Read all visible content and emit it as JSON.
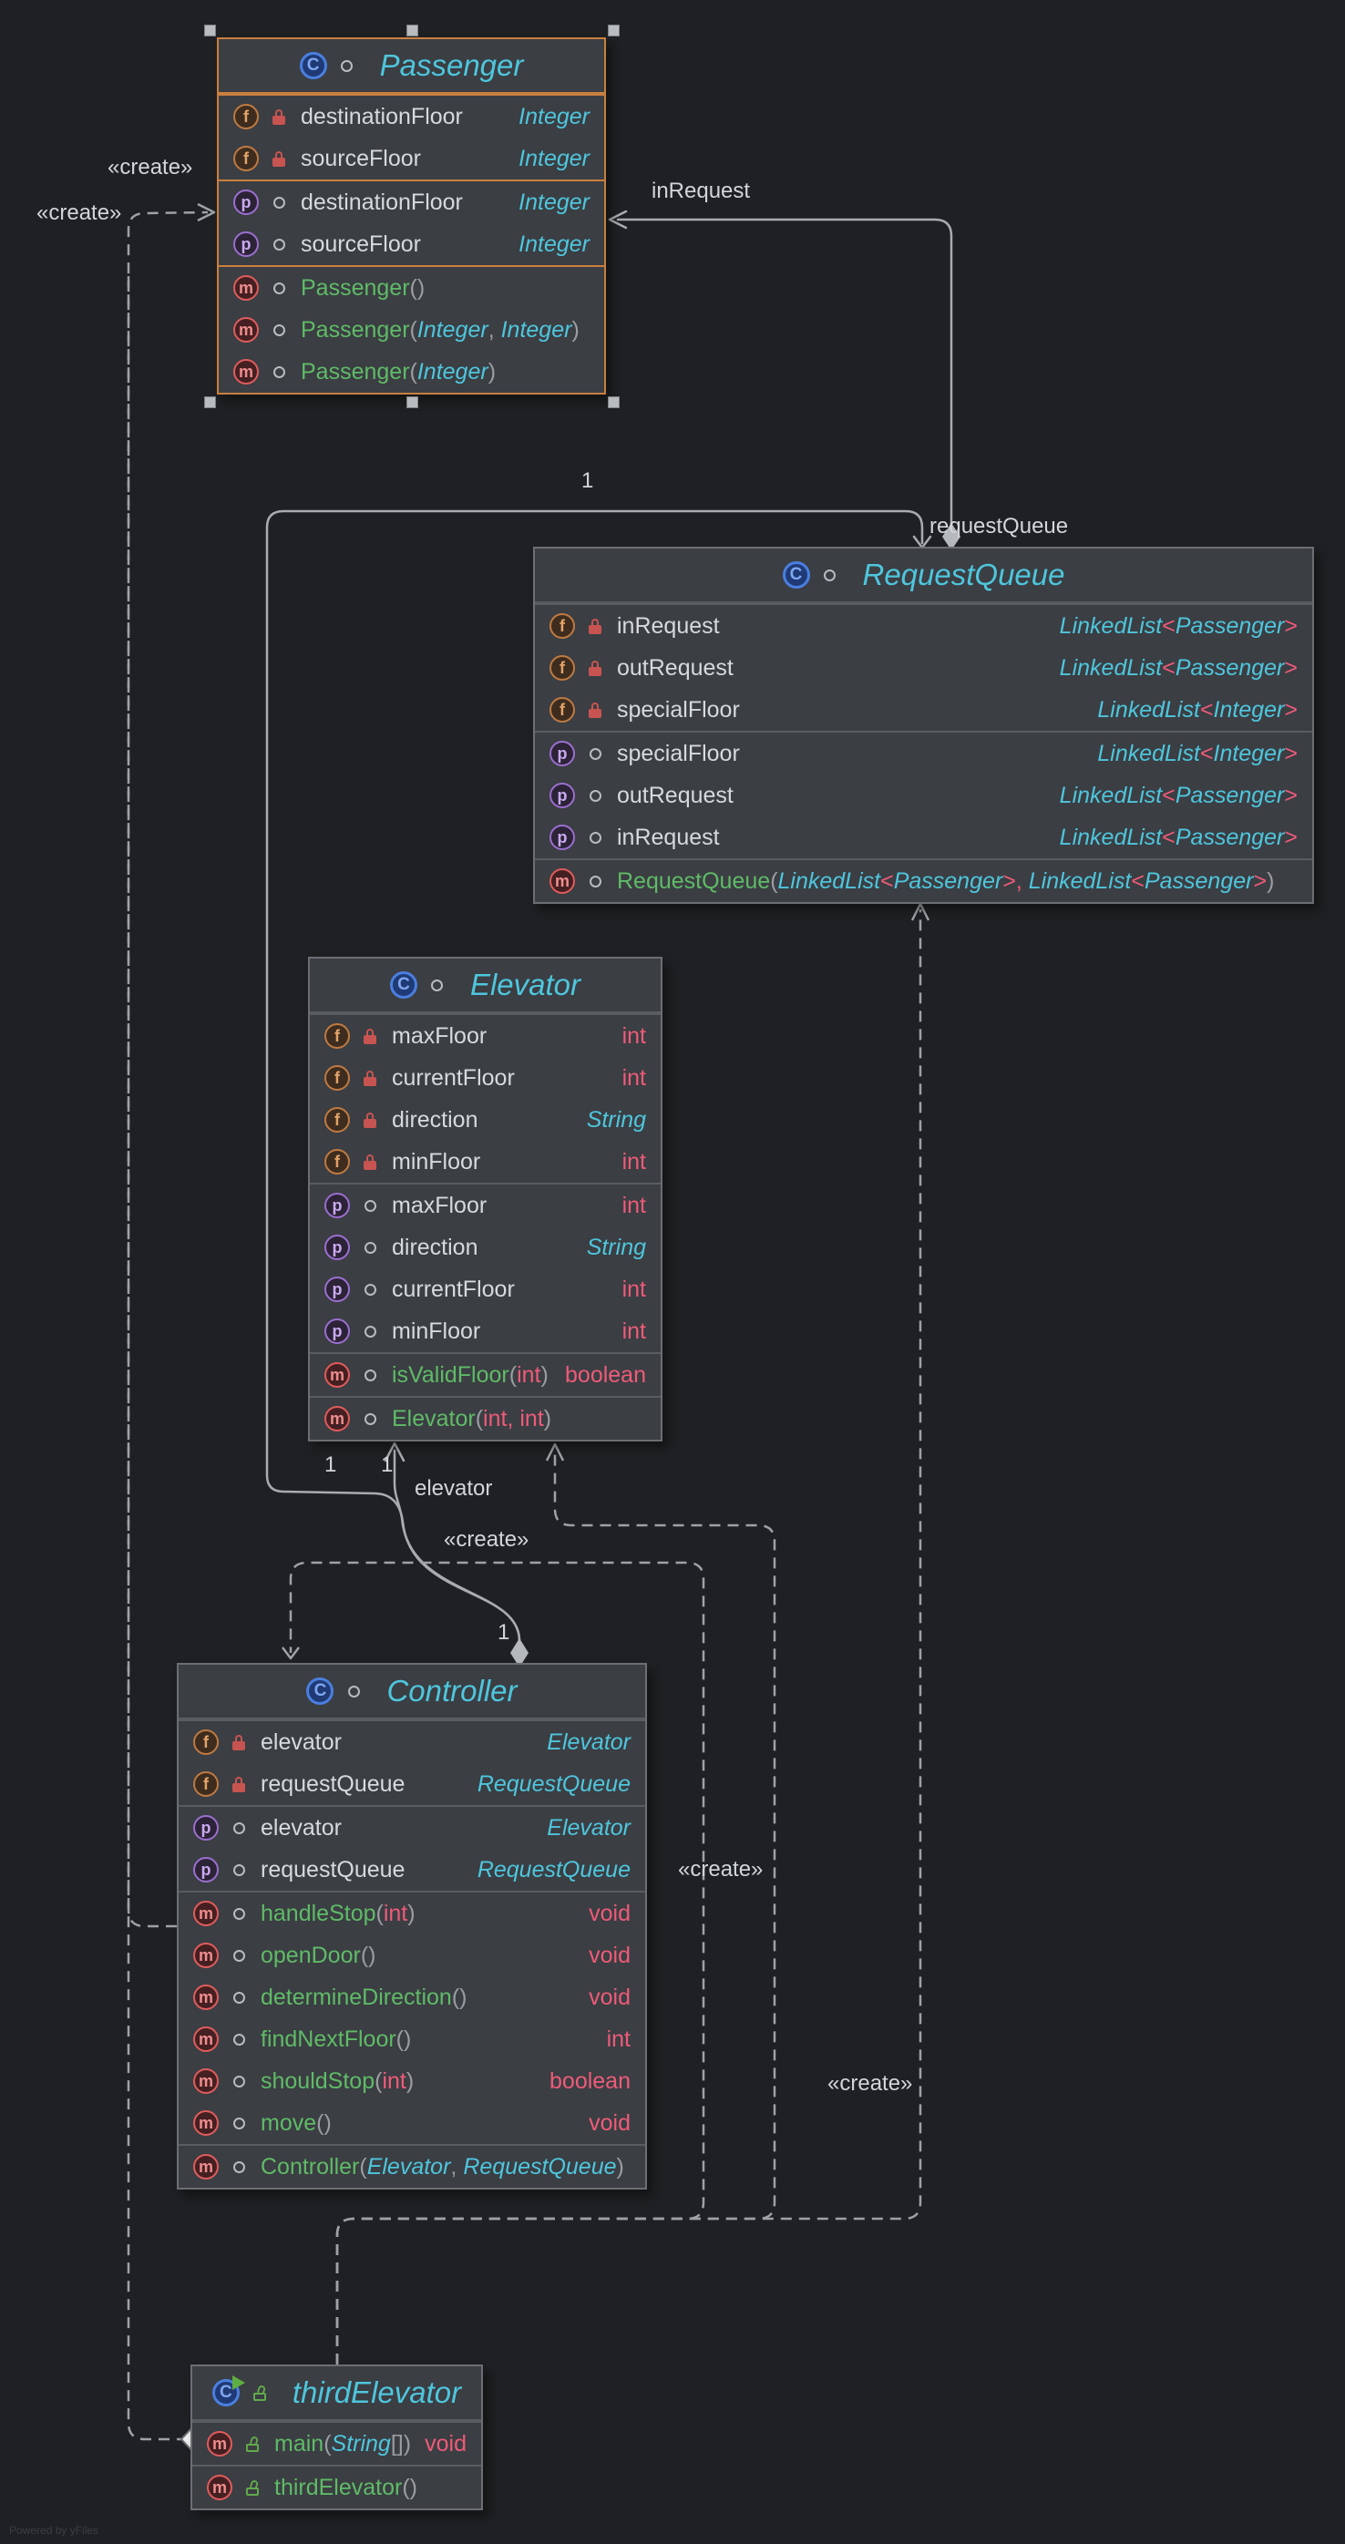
{
  "diagram": {
    "watermark": "Powered by yFiles",
    "labels": {
      "create": "«create»",
      "in_request": "inRequest",
      "request_queue": "requestQueue",
      "elevator": "elevator",
      "one": "1"
    },
    "colors": {
      "background": "#1e2023",
      "node_fill": "#3b3e43",
      "node_border": "#6b6e73",
      "selected_border": "#c9803f",
      "title_cyan": "#4ec6dd",
      "method_green": "#5fbb67",
      "primitive_pink": "#ee5b79",
      "edge_gray": "#a6a9ac"
    },
    "classes": [
      {
        "id": "passenger",
        "title": "Passenger",
        "icon": "class",
        "selected": true,
        "sections": [
          [
            {
              "kind": "f",
              "access": "private",
              "name": "destinationFloor",
              "type": [
                [
                  "Integer",
                  "sc"
                ]
              ]
            },
            {
              "kind": "f",
              "access": "private",
              "name": "sourceFloor",
              "type": [
                [
                  "Integer",
                  "sc"
                ]
              ]
            }
          ],
          [
            {
              "kind": "p",
              "access": "public",
              "name": "destinationFloor",
              "type": [
                [
                  "Integer",
                  "sc"
                ]
              ]
            },
            {
              "kind": "p",
              "access": "public",
              "name": "sourceFloor",
              "type": [
                [
                  "Integer",
                  "sc"
                ]
              ]
            }
          ],
          [
            {
              "kind": "m",
              "access": "public",
              "name": "Passenger",
              "sig": [
                [
                  "()",
                  "sg"
                ]
              ]
            },
            {
              "kind": "m",
              "access": "public",
              "name": "Passenger",
              "sig": [
                [
                  "(",
                  "sg"
                ],
                [
                  "Integer",
                  "sc"
                ],
                [
                  ", ",
                  "sg"
                ],
                [
                  "Integer",
                  "sc"
                ],
                [
                  ")",
                  "sg"
                ]
              ]
            },
            {
              "kind": "m",
              "access": "public",
              "name": "Passenger",
              "sig": [
                [
                  "(",
                  "sg"
                ],
                [
                  "Integer",
                  "sc"
                ],
                [
                  ")",
                  "sg"
                ]
              ]
            }
          ]
        ]
      },
      {
        "id": "requestqueue",
        "title": "RequestQueue",
        "icon": "class",
        "selected": false,
        "sections": [
          [
            {
              "kind": "f",
              "access": "private",
              "name": "inRequest",
              "type": [
                [
                  "LinkedList",
                  "sc"
                ],
                [
                  "<",
                  "sk"
                ],
                [
                  "Passenger",
                  "sc"
                ],
                [
                  ">",
                  "sk"
                ]
              ]
            },
            {
              "kind": "f",
              "access": "private",
              "name": "outRequest",
              "type": [
                [
                  "LinkedList",
                  "sc"
                ],
                [
                  "<",
                  "sk"
                ],
                [
                  "Passenger",
                  "sc"
                ],
                [
                  ">",
                  "sk"
                ]
              ]
            },
            {
              "kind": "f",
              "access": "private",
              "name": "specialFloor",
              "type": [
                [
                  "LinkedList",
                  "sc"
                ],
                [
                  "<",
                  "sk"
                ],
                [
                  "Integer",
                  "sc"
                ],
                [
                  ">",
                  "sk"
                ]
              ]
            }
          ],
          [
            {
              "kind": "p",
              "access": "public",
              "name": "specialFloor",
              "type": [
                [
                  "LinkedList",
                  "sc"
                ],
                [
                  "<",
                  "sk"
                ],
                [
                  "Integer",
                  "sc"
                ],
                [
                  ">",
                  "sk"
                ]
              ]
            },
            {
              "kind": "p",
              "access": "public",
              "name": "outRequest",
              "type": [
                [
                  "LinkedList",
                  "sc"
                ],
                [
                  "<",
                  "sk"
                ],
                [
                  "Passenger",
                  "sc"
                ],
                [
                  ">",
                  "sk"
                ]
              ]
            },
            {
              "kind": "p",
              "access": "public",
              "name": "inRequest",
              "type": [
                [
                  "LinkedList",
                  "sc"
                ],
                [
                  "<",
                  "sk"
                ],
                [
                  "Passenger",
                  "sc"
                ],
                [
                  ">",
                  "sk"
                ]
              ]
            }
          ],
          [
            {
              "kind": "m",
              "access": "public",
              "name": "RequestQueue",
              "sig": [
                [
                  "(",
                  "sg"
                ],
                [
                  "LinkedList",
                  "sc"
                ],
                [
                  "<",
                  "sk"
                ],
                [
                  "Passenger",
                  "sc"
                ],
                [
                  ">",
                  "sk"
                ],
                [
                  ", ",
                  "sk"
                ],
                [
                  "LinkedList",
                  "sc"
                ],
                [
                  "<",
                  "sk"
                ],
                [
                  "Passenger",
                  "sc"
                ],
                [
                  ">",
                  "sk"
                ],
                [
                  ")",
                  "sg"
                ]
              ]
            }
          ]
        ]
      },
      {
        "id": "elevator",
        "title": "Elevator",
        "icon": "class",
        "selected": false,
        "sections": [
          [
            {
              "kind": "f",
              "access": "private",
              "name": "maxFloor",
              "type": [
                [
                  "int",
                  "sp"
                ]
              ]
            },
            {
              "kind": "f",
              "access": "private",
              "name": "currentFloor",
              "type": [
                [
                  "int",
                  "sp"
                ]
              ]
            },
            {
              "kind": "f",
              "access": "private",
              "name": "direction",
              "type": [
                [
                  "String",
                  "sc"
                ]
              ]
            },
            {
              "kind": "f",
              "access": "private",
              "name": "minFloor",
              "type": [
                [
                  "int",
                  "sp"
                ]
              ]
            }
          ],
          [
            {
              "kind": "p",
              "access": "public",
              "name": "maxFloor",
              "type": [
                [
                  "int",
                  "sp"
                ]
              ]
            },
            {
              "kind": "p",
              "access": "public",
              "name": "direction",
              "type": [
                [
                  "String",
                  "sc"
                ]
              ]
            },
            {
              "kind": "p",
              "access": "public",
              "name": "currentFloor",
              "type": [
                [
                  "int",
                  "sp"
                ]
              ]
            },
            {
              "kind": "p",
              "access": "public",
              "name": "minFloor",
              "type": [
                [
                  "int",
                  "sp"
                ]
              ]
            }
          ],
          [
            {
              "kind": "m",
              "access": "public",
              "name": "isValidFloor",
              "sig": [
                [
                  " (",
                  "sg"
                ],
                [
                  "int",
                  "sp"
                ],
                [
                  ")",
                  "sg"
                ]
              ],
              "type": [
                [
                  "boolean",
                  "sp"
                ]
              ]
            }
          ],
          [
            {
              "kind": "m",
              "access": "public",
              "name": "Elevator",
              "sig": [
                [
                  " (",
                  "sg"
                ],
                [
                  "int",
                  "sp"
                ],
                [
                  ", ",
                  "sp"
                ],
                [
                  "int",
                  "sp"
                ],
                [
                  ")",
                  "sg"
                ]
              ]
            }
          ]
        ]
      },
      {
        "id": "controller",
        "title": "Controller",
        "icon": "class",
        "selected": false,
        "sections": [
          [
            {
              "kind": "f",
              "access": "private",
              "name": "elevator",
              "type": [
                [
                  "Elevator",
                  "sc"
                ]
              ]
            },
            {
              "kind": "f",
              "access": "private",
              "name": "requestQueue",
              "type": [
                [
                  "RequestQueue",
                  "sc"
                ]
              ]
            }
          ],
          [
            {
              "kind": "p",
              "access": "public",
              "name": "elevator",
              "type": [
                [
                  "Elevator",
                  "sc"
                ]
              ]
            },
            {
              "kind": "p",
              "access": "public",
              "name": "requestQueue",
              "type": [
                [
                  "RequestQueue",
                  "sc"
                ]
              ]
            }
          ],
          [
            {
              "kind": "m",
              "access": "public",
              "name": "handleStop",
              "sig": [
                [
                  " (",
                  "sg"
                ],
                [
                  "int",
                  "sp"
                ],
                [
                  ")",
                  "sg"
                ]
              ],
              "type": [
                [
                  "void",
                  "sp"
                ]
              ]
            },
            {
              "kind": "m",
              "access": "public",
              "name": "openDoor",
              "sig": [
                [
                  " ()",
                  "sg"
                ]
              ],
              "type": [
                [
                  "void",
                  "sp"
                ]
              ]
            },
            {
              "kind": "m",
              "access": "public",
              "name": "determineDirection",
              "sig": [
                [
                  " ()",
                  "sg"
                ]
              ],
              "type": [
                [
                  "void",
                  "sp"
                ]
              ]
            },
            {
              "kind": "m",
              "access": "public",
              "name": "findNextFloor",
              "sig": [
                [
                  " ()",
                  "sg"
                ]
              ],
              "type": [
                [
                  "int",
                  "sp"
                ]
              ]
            },
            {
              "kind": "m",
              "access": "public",
              "name": "shouldStop",
              "sig": [
                [
                  " (",
                  "sg"
                ],
                [
                  "int",
                  "sp"
                ],
                [
                  ")",
                  "sg"
                ]
              ],
              "type": [
                [
                  "boolean",
                  "sp"
                ]
              ]
            },
            {
              "kind": "m",
              "access": "public",
              "name": "move",
              "sig": [
                [
                  " ()",
                  "sg"
                ]
              ],
              "type": [
                [
                  "void",
                  "sp"
                ]
              ]
            }
          ],
          [
            {
              "kind": "m",
              "access": "public",
              "name": "Controller",
              "sig": [
                [
                  " (",
                  "sg"
                ],
                [
                  "Elevator",
                  "sc"
                ],
                [
                  ", ",
                  "sg"
                ],
                [
                  "RequestQueue",
                  "sc"
                ],
                [
                  ")",
                  "sg"
                ]
              ]
            }
          ]
        ]
      },
      {
        "id": "thirdelevator",
        "title": "thirdElevator",
        "icon": "runnable-class",
        "selected": false,
        "sections": [
          [
            {
              "kind": "m",
              "access": "public-open",
              "name": "main",
              "sig": [
                [
                  "(",
                  "sg"
                ],
                [
                  "String",
                  "sc"
                ],
                [
                  "[]",
                  "sg"
                ],
                [
                  ")",
                  "sg"
                ]
              ],
              "type": [
                [
                  "void",
                  "sp"
                ]
              ]
            }
          ],
          [
            {
              "kind": "m",
              "access": "public-open",
              "name": "thirdElevator",
              "sig": [
                [
                  " ()",
                  "sg"
                ]
              ]
            }
          ]
        ]
      }
    ]
  }
}
